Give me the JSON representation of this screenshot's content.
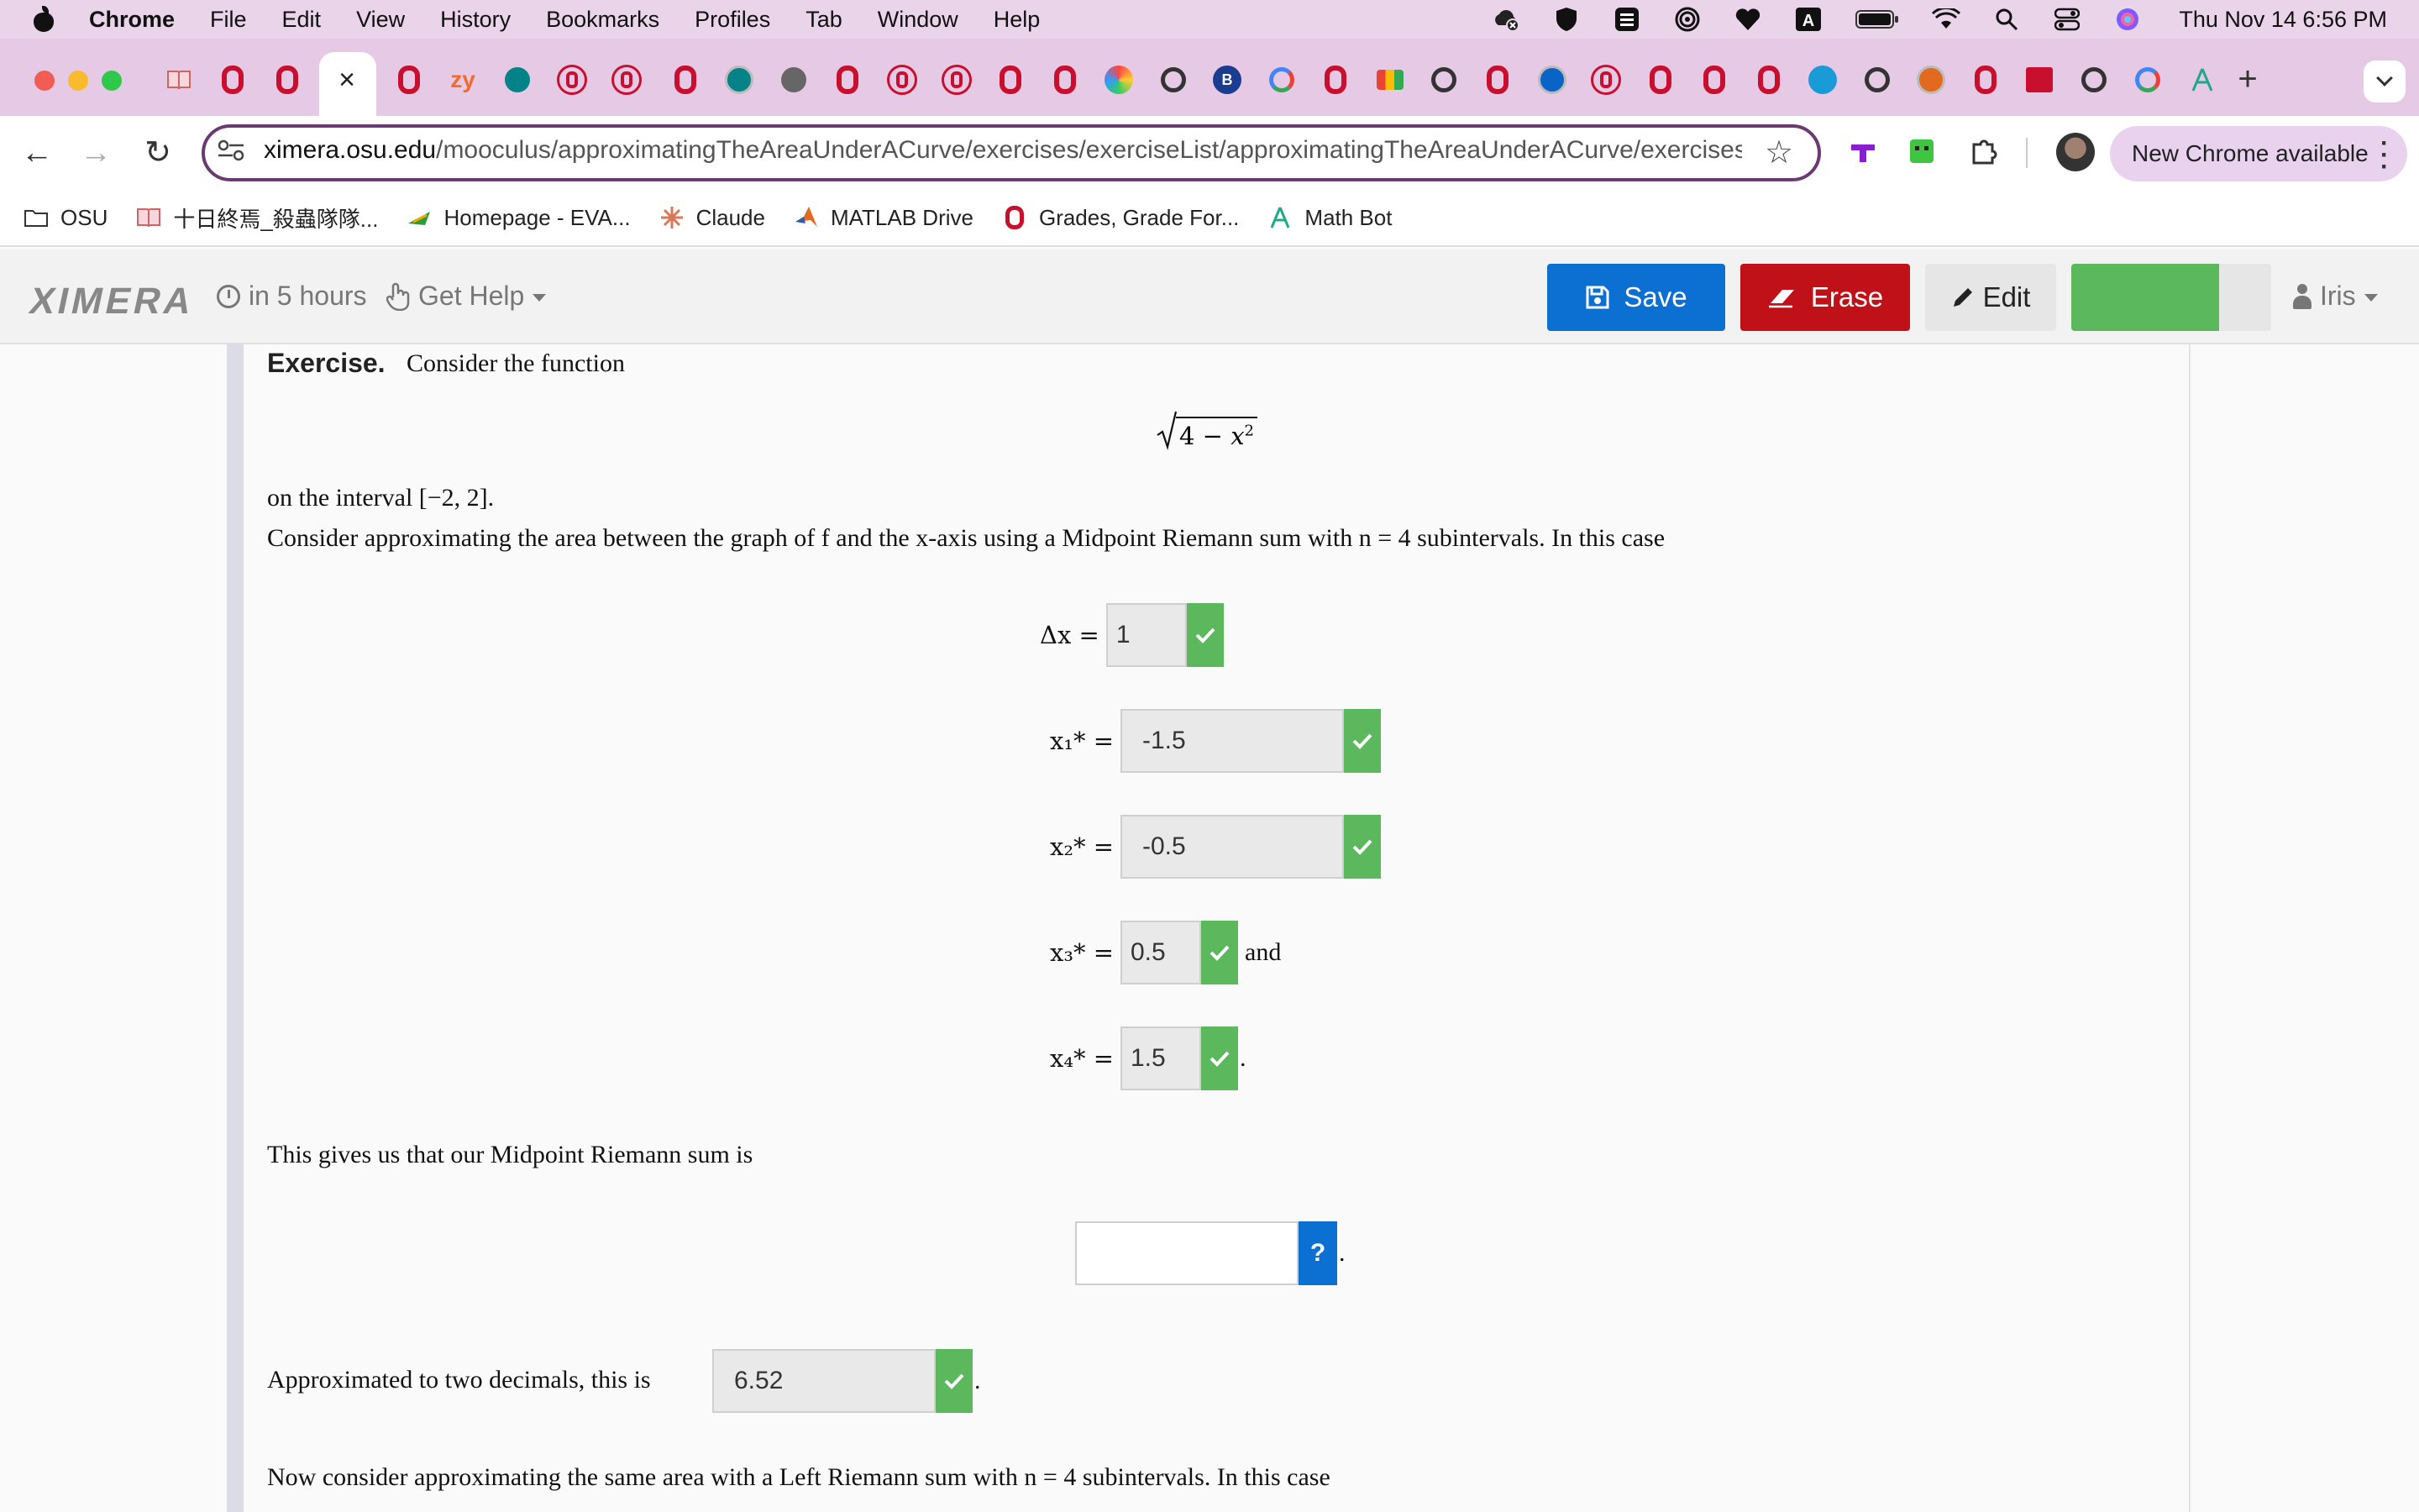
{
  "menubar": {
    "app": "Chrome",
    "items": [
      "File",
      "Edit",
      "View",
      "History",
      "Bookmarks",
      "Profiles",
      "Tab",
      "Window",
      "Help"
    ],
    "clock": "Thu Nov 14  6:56 PM"
  },
  "browser": {
    "url_host": "ximera.osu.edu",
    "url_path": "/mooculus/approximatingTheAreaUnderACurve/exercises/exerciseList/approximatingTheAreaUnderACurve/exercises/...",
    "update_chip": "New Chrome available"
  },
  "bookmarks": [
    "OSU",
    "十日終焉_殺蟲隊隊...",
    "Homepage - EVA...",
    "Claude",
    "MATLAB Drive",
    "Grades, Grade For...",
    "Math Bot"
  ],
  "ximera": {
    "logo": "XIMERA",
    "deadline": "in 5 hours",
    "help": "Get Help",
    "save": "Save",
    "erase": "Erase",
    "edit": "Edit",
    "user": "Iris"
  },
  "exercise": {
    "label": "Exercise.",
    "intro": "Consider the function",
    "function_display": "√4 − x²",
    "interval_text": "on the interval [−2, 2].",
    "question": "Consider approximating the area between the graph of f and the x-axis using a Midpoint Riemann sum with n = 4 subintervals. In this case",
    "rows": [
      {
        "label": "Δx =",
        "value": "1",
        "after": ""
      },
      {
        "label": "x₁* =",
        "value": "-1.5",
        "after": ""
      },
      {
        "label": "x₂* =",
        "value": "-0.5",
        "after": ""
      },
      {
        "label": "x₃* =",
        "value": "0.5",
        "after": "and"
      },
      {
        "label": "x₄* =",
        "value": "1.5",
        "after": "."
      }
    ],
    "sum_text": "This gives us that our Midpoint Riemann sum is",
    "sum_value": "",
    "help_label": "?",
    "approx_text": "Approximated to two decimals, this is",
    "approx_value": "6.52",
    "left_text": "Now consider approximating the same area with a Left Riemann sum with n = 4 subintervals. In this case"
  }
}
